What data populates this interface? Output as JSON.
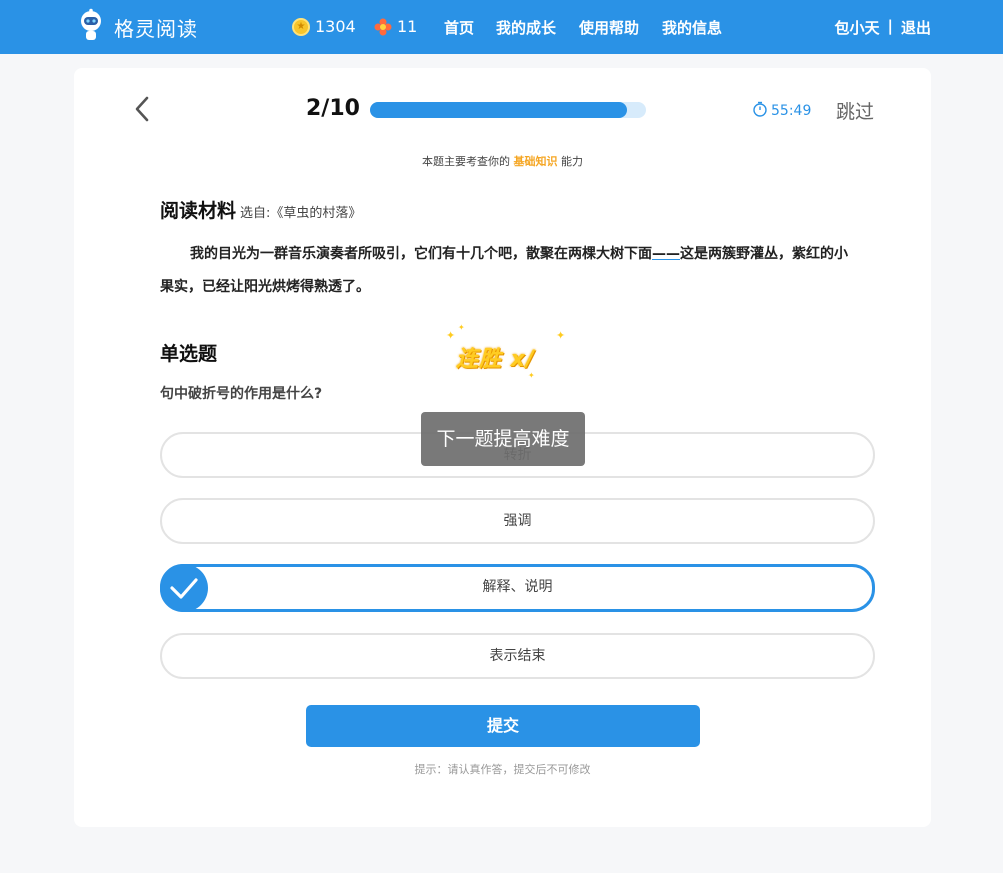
{
  "header": {
    "app_name": "格灵阅读",
    "logo_icon": "robot-mascot-icon",
    "coins": "1304",
    "coin_icon": "coin-icon",
    "flowers": "11",
    "flower_icon": "flower-icon",
    "nav": [
      "首页",
      "我的成长",
      "使用帮助",
      "我的信息"
    ],
    "user_name": "包小天",
    "separator": "|",
    "logout": "退出",
    "brand_color": "#2a92e6"
  },
  "quiz": {
    "progress_label": "2/10",
    "progress_fraction": 0.93,
    "timer": "55:49",
    "skip_label": "跳过",
    "ability_prefix": "本题主要考查你的",
    "ability_name": "基础知识",
    "ability_suffix": "能力",
    "material_title": "阅读材料",
    "material_source": "选自:《草虫的村落》",
    "passage_before": "我的目光为一群音乐演奏者所吸引，它们有十几个吧，散聚在两棵大树下面",
    "passage_dash": "——",
    "passage_after": "这是两簇野灌丛，紫红的小果实，已经让阳光烘烤得熟透了。",
    "question_type": "单选题",
    "question": "句中破折号的作用是什么?",
    "options": [
      "转折",
      "强调",
      "解释、说明",
      "表示结束"
    ],
    "selected_index": 2,
    "streak_label": "连胜 x/",
    "toast": "下一题提高难度",
    "submit_label": "提交",
    "tip": "提示：请认真作答，提交后不可修改"
  }
}
